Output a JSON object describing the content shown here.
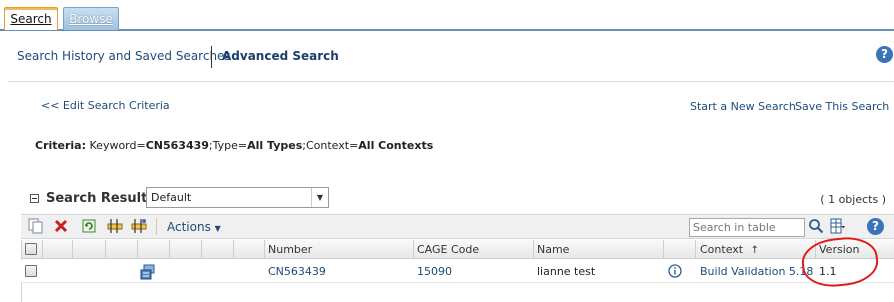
{
  "tabs": [
    {
      "label": "Search",
      "active": true
    },
    {
      "label": "Browse",
      "active": false
    }
  ],
  "subnav": {
    "history_label": "Search History and Saved Searches",
    "advanced_label": "Advanced Search",
    "help_glyph": "?"
  },
  "links": {
    "edit_criteria": "<< Edit Search Criteria",
    "new_search": "Start a New Search",
    "save_search": "Save This Search"
  },
  "criteria": {
    "label": "Criteria:",
    "keyword_key": "Keyword=",
    "keyword_val": "CN563439",
    "type_key": ";Type=",
    "type_val": "All Types",
    "context_key": ";Context=",
    "context_val": "All Contexts"
  },
  "results": {
    "title": "Search Results",
    "view_value": "Default",
    "count": "( 1 objects )"
  },
  "toolbar": {
    "actions_label": "Actions",
    "search_placeholder": "Search in table",
    "icons": [
      "copy-icon",
      "delete-icon",
      "refresh-icon",
      "insert-icon",
      "paste-icon",
      "search-icon",
      "column-settings-icon",
      "help-icon"
    ]
  },
  "table": {
    "headers": {
      "number": "Number",
      "cage": "CAGE Code",
      "name": "Name",
      "context": "Context",
      "context_sort": "↑",
      "version": "Version"
    },
    "rows": [
      {
        "number": "CN563439",
        "cage": "15090",
        "name": "lianne test",
        "context": "Build Validation 5.18",
        "version": "1.1"
      }
    ]
  },
  "colors": {
    "link": "#1f4a7a",
    "tab_active_border": "#e0a03a",
    "tab_inactive_bg": "#9fc1df",
    "annotation": "#e01b1b"
  }
}
